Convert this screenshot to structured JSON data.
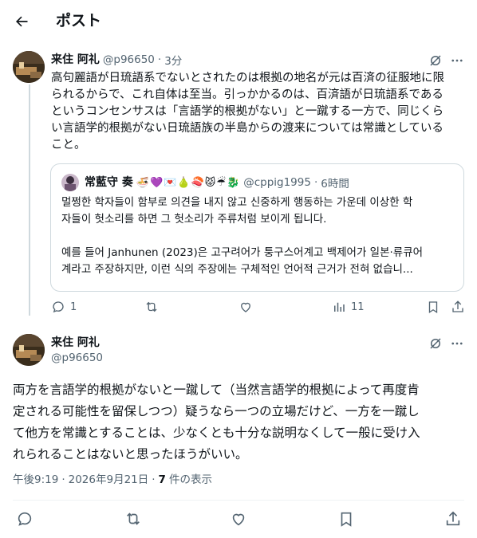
{
  "header": {
    "title": "ポスト"
  },
  "reply": {
    "author_name": "来住 阿礼",
    "author_handle": "@p96650",
    "time": "3分",
    "dot": "·",
    "text_lines": [
      "高句麗語が日琉語系でないとされたのは根拠の地名が元は百済の征服地に限",
      "られるからで、これ自体は至当。引っかかるのは、百済語が日琉語系である",
      "というコンセンサスは「言語学的根拠がない」と一蹴する一方で、同じくら",
      "い言語学的根拠がない日琉語族の半島からの渡来については常識としている",
      "こと。"
    ],
    "actions": {
      "reply_count": "1",
      "views_count": "11"
    }
  },
  "quote": {
    "author_name": "常藍守 奏",
    "emoji": "🍜💜💌🍐🍣😾☔🐉",
    "author_handle": "@cppig1995",
    "time": "6時間",
    "dot": "·",
    "text_lines": [
      "멀쩡한 학자들이 함부로 의견을 내지 않고 신중하게 행동하는 가운데 이상한 학",
      "자들이 헛소리를 하면 그 헛소리가 주류처럼 보이게 됩니다.",
      "",
      "예를 들어 Janhunen (2023)은 고구려어가 퉁구스어계고 백제어가 일본·류큐어",
      "계라고 주장하지만, 이런 식의 주장에는 구체적인 언어적 근거가 전혀 없습니..."
    ]
  },
  "main": {
    "author_name": "来住 阿礼",
    "author_handle": "@p96650",
    "text_lines": [
      "両方を言語学的根拠がないと一蹴して（当然言語学的根拠によって再度肯",
      "定される可能性を留保しつつ）疑うなら一つの立場だけど、一方を一蹴し",
      "て他方を常識とすることは、少なくとも十分な説明なくして一般に受け入",
      "れられることはないと思ったほうがいい。"
    ],
    "meta_time": "午後9:19",
    "meta_date": "2026年9月21日",
    "meta_sep": "·",
    "views_count": "7",
    "views_label": "件の表示"
  },
  "icons": {
    "back": "arrow-left-icon",
    "grok": "grok-icon",
    "more": "more-icon",
    "reply": "reply-icon",
    "retweet": "retweet-icon",
    "like": "heart-icon",
    "views": "views-icon",
    "bookmark": "bookmark-icon",
    "share": "share-icon"
  }
}
